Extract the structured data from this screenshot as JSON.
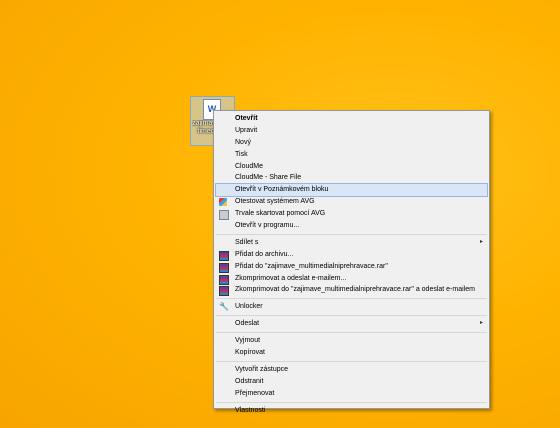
{
  "desktop_icon": {
    "glyph": "W",
    "label": "zajimave multimedial..."
  },
  "menu": {
    "items": [
      {
        "label": "Otevřít",
        "bold": true
      },
      {
        "label": "Upravit"
      },
      {
        "label": "Nový"
      },
      {
        "label": "Tisk"
      },
      {
        "label": "CloudMe"
      },
      {
        "label": "CloudMe - Share File"
      },
      {
        "label": "Otevřít v Poznámkovém bloku",
        "highlighted": true
      },
      {
        "label": "Otestovat systémem AVG",
        "icon": "avg-icon"
      },
      {
        "label": "Trvale skartovat pomocí AVG",
        "icon": "shredder-icon"
      },
      {
        "label": "Otevřít v programu..."
      },
      {
        "label": "Sdílet s",
        "submenu": true
      },
      {
        "label": "Přidat do archivu...",
        "icon": "winrar-icon"
      },
      {
        "label": "Přidat do \"zajimave_multimedialniprehravace.rar\"",
        "icon": "winrar-icon"
      },
      {
        "label": "Zkomprimovat a odeslat e-mailem...",
        "icon": "winrar-icon"
      },
      {
        "label": "Zkomprimovat do \"zajimave_multimedialniprehravace.rar\" a odeslat e-mailem",
        "icon": "winrar-icon"
      },
      {
        "label": "Unlocker",
        "icon": "unlocker-icon"
      },
      {
        "label": "Odeslat",
        "submenu": true
      },
      {
        "label": "Vyjmout"
      },
      {
        "label": "Kopírovat"
      },
      {
        "label": "Vytvořit zástupce"
      },
      {
        "label": "Odstranit"
      },
      {
        "label": "Přejmenovat"
      },
      {
        "label": "Vlastnosti"
      }
    ],
    "submenu_arrow": "▸"
  }
}
